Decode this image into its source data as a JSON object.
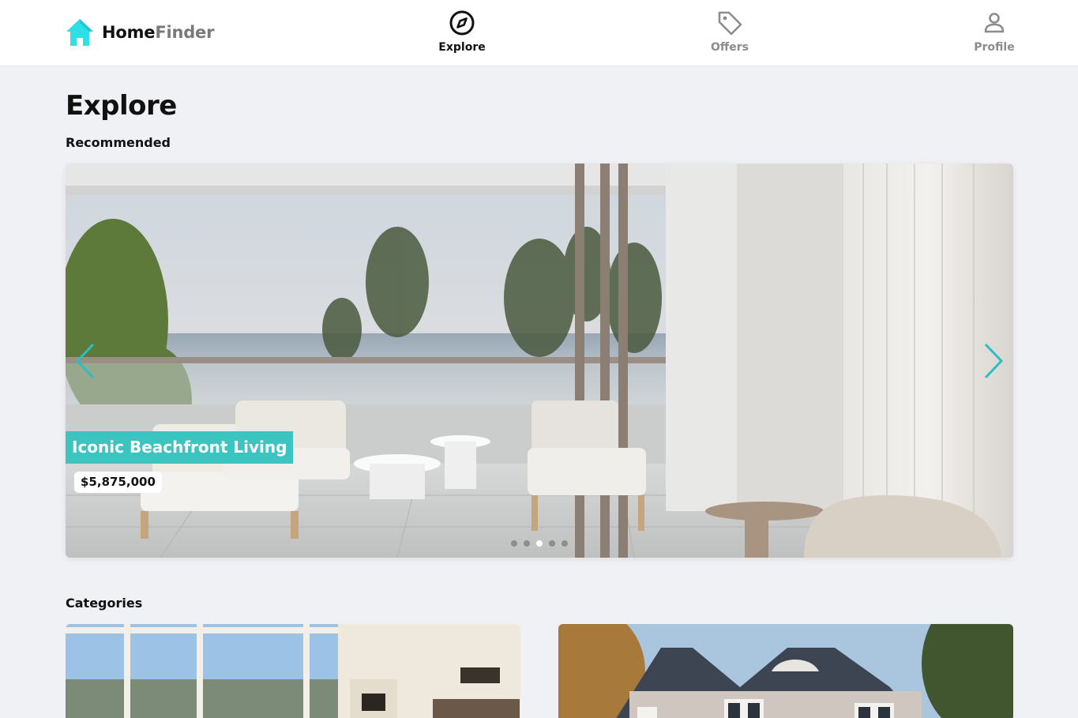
{
  "app": {
    "brand_home": "Home",
    "brand_finder": "Finder",
    "logo_icon": "house-icon",
    "accent": "#2ee0e6"
  },
  "nav": [
    {
      "label": "Explore",
      "icon": "compass-icon",
      "active": true
    },
    {
      "label": "Offers",
      "icon": "tag-icon",
      "active": false
    },
    {
      "label": "Profile",
      "icon": "user-icon",
      "active": false
    }
  ],
  "page": {
    "title": "Explore"
  },
  "sections": {
    "recommended": "Recommended",
    "categories": "Categories"
  },
  "carousel": {
    "slide_title": "Iconic Beachfront Living",
    "slide_price": "$5,875,000",
    "dot_count": 5,
    "active_dot": 3,
    "title_bg": "#3bc4c0",
    "arrow_color": "#2bbfc3"
  }
}
